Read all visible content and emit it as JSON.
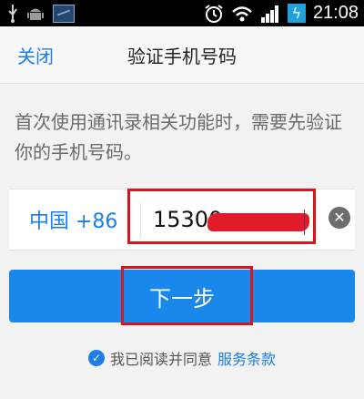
{
  "status_bar": {
    "time": "21:08",
    "icons": [
      "usb-icon",
      "android-icon",
      "image-icon",
      "alarm-icon",
      "wifi-icon",
      "signal-icon",
      "battery-charging-icon"
    ]
  },
  "header": {
    "close_label": "关闭",
    "title": "验证手机号码"
  },
  "description": "首次使用通讯录相关功能时，需要先验证你的手机号码。",
  "phone": {
    "country_code": "中国 +86",
    "value": "15300"
  },
  "next_button": "下一步",
  "agreement": {
    "text": "我已阅读并同意",
    "link": "服务条款"
  },
  "colors": {
    "accent": "#1c7ee6",
    "button": "#1a87ea",
    "annotation": "#d6161e"
  }
}
